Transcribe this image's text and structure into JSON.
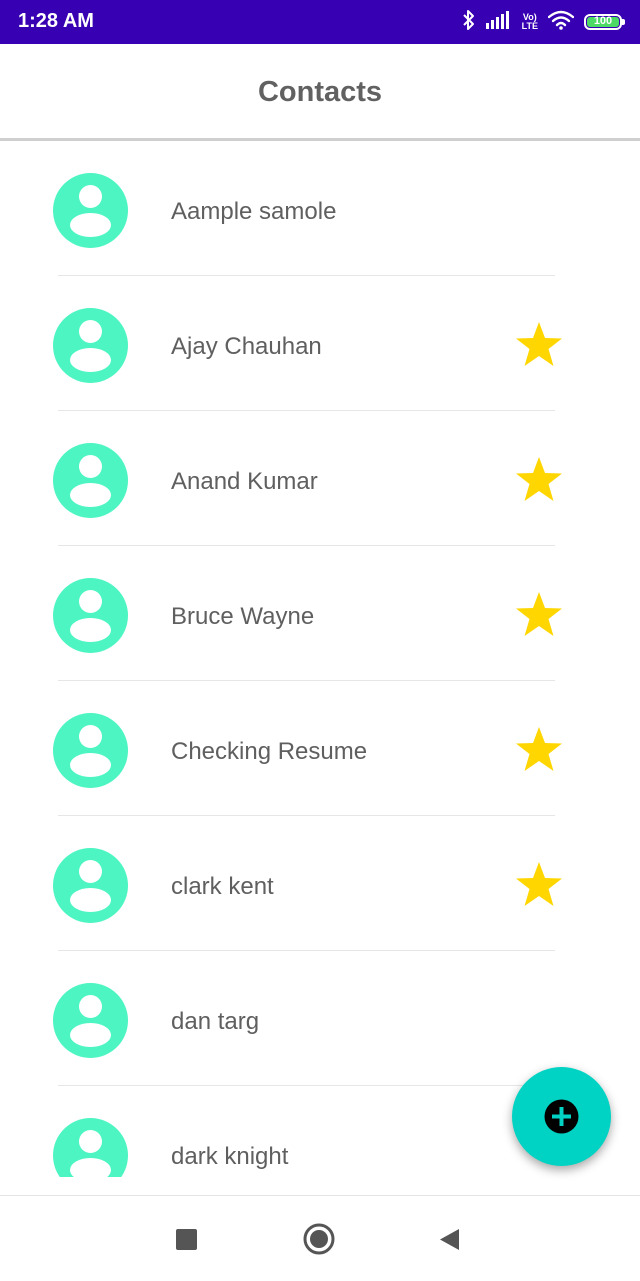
{
  "status_bar": {
    "time": "1:28 AM",
    "network_top": "Vo)",
    "network_bottom": "LTE",
    "battery_level": "100",
    "background_color": "#3700b3",
    "icons": [
      "bluetooth-icon",
      "signal-icon",
      "volte-icon",
      "wifi-icon",
      "battery-icon"
    ]
  },
  "app_bar": {
    "title": "Contacts"
  },
  "contacts": [
    {
      "name": "Aample samole",
      "favorite": false
    },
    {
      "name": "Ajay Chauhan",
      "favorite": true
    },
    {
      "name": "Anand Kumar",
      "favorite": true
    },
    {
      "name": "Bruce Wayne",
      "favorite": true
    },
    {
      "name": "Checking Resume",
      "favorite": true
    },
    {
      "name": "clark kent",
      "favorite": true
    },
    {
      "name": "dan targ",
      "favorite": false
    },
    {
      "name": "dark knight",
      "favorite": false
    }
  ],
  "colors": {
    "avatar": "#4cf5c1",
    "star": "#ffd600",
    "fab": "#00d3c3",
    "title_text": "#616161"
  },
  "fab": {
    "icon": "add-icon"
  },
  "nav_bar": {
    "icons": [
      "recents-square-icon",
      "home-circle-icon",
      "back-triangle-icon"
    ]
  }
}
